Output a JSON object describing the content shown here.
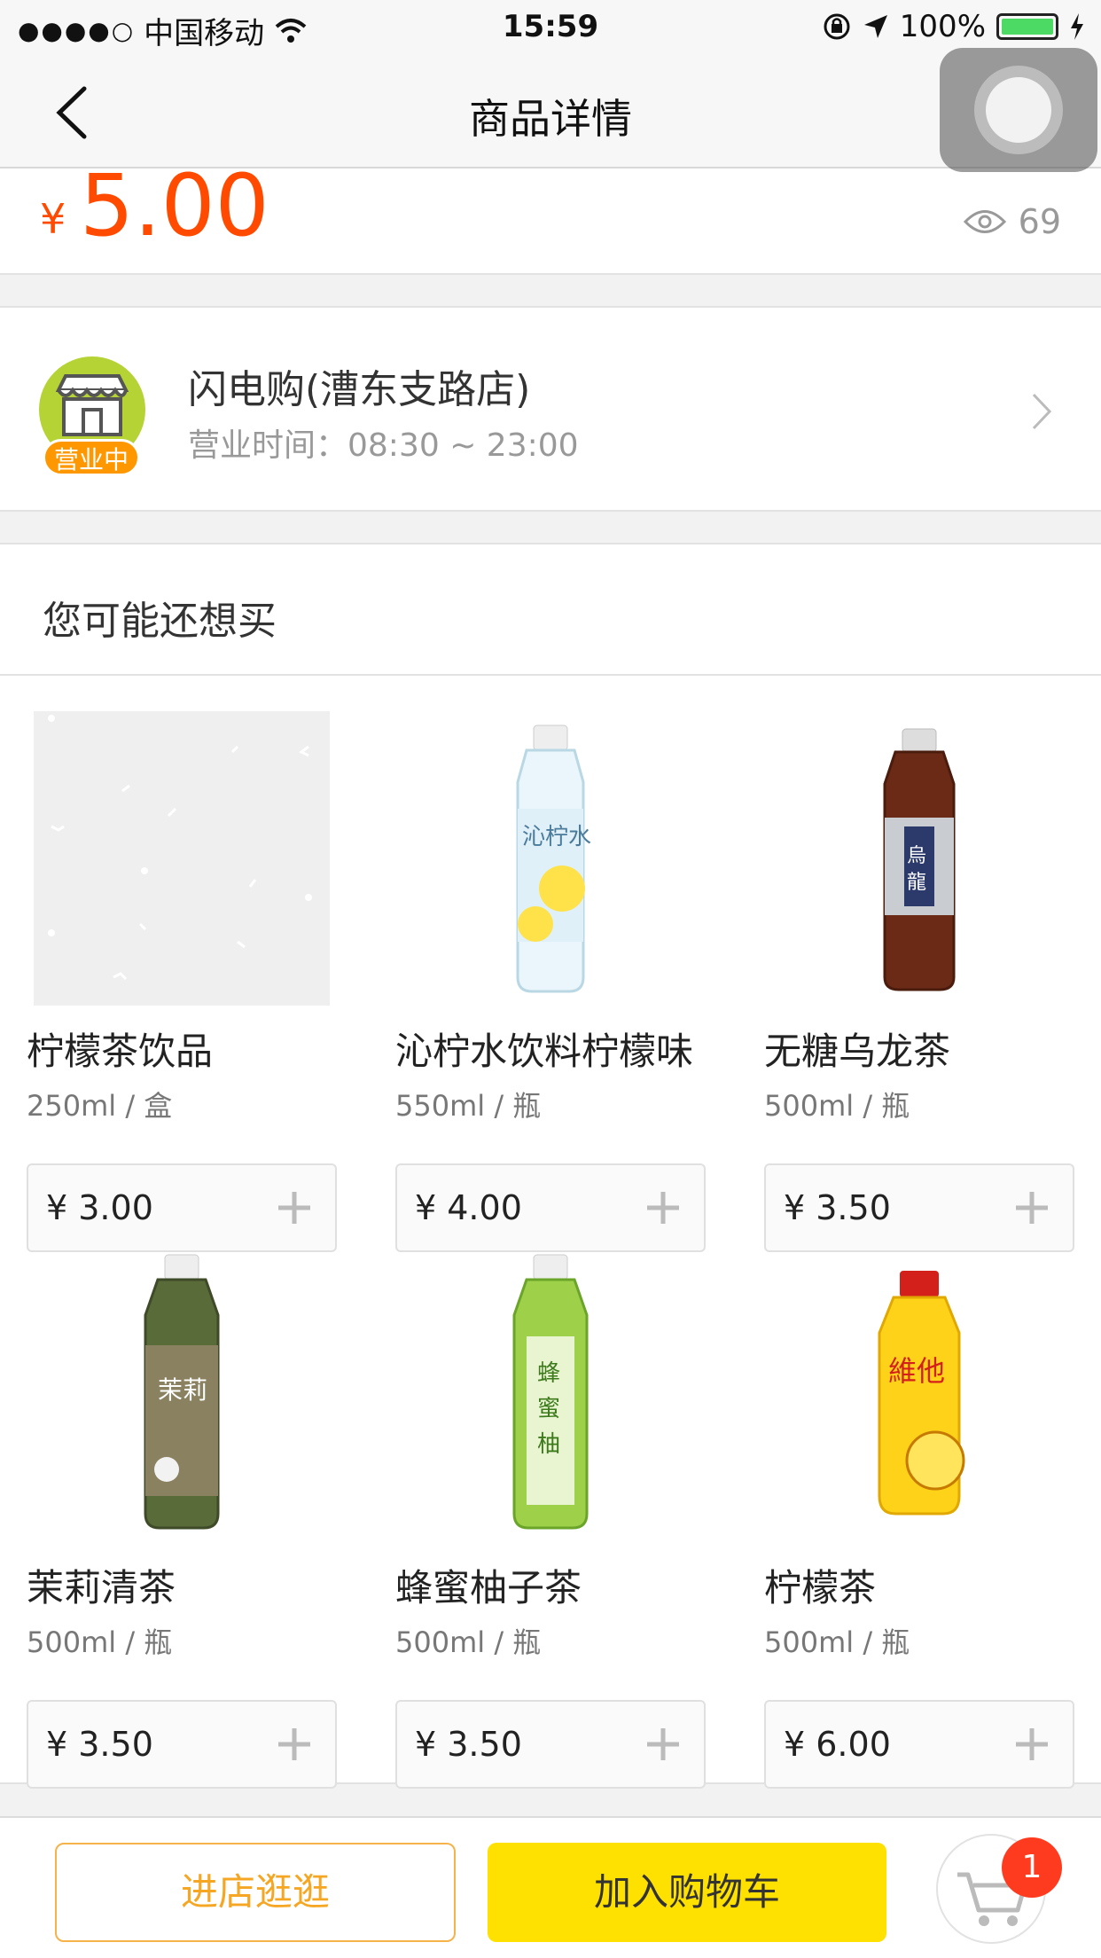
{
  "status_bar": {
    "carrier": "中国移动",
    "time": "15:59",
    "battery": "100%"
  },
  "nav": {
    "title": "商品详情"
  },
  "product": {
    "currency": "¥",
    "price": "5.00",
    "views": "69"
  },
  "store": {
    "name": "闪电购(漕东支路店)",
    "hours": "营业时间：08:30 ~ 23:00",
    "badge": "营业中"
  },
  "recommend": {
    "title": "您可能还想买",
    "items": [
      {
        "name": "柠檬茶饮品",
        "spec": "250ml / 盒",
        "price": "¥ 3.00"
      },
      {
        "name": "沁柠水饮料柠檬味",
        "spec": "550ml / 瓶",
        "price": "¥ 4.00"
      },
      {
        "name": "无糖乌龙茶",
        "spec": "500ml / 瓶",
        "price": "¥ 3.50"
      },
      {
        "name": "茉莉清茶",
        "spec": "500ml / 瓶",
        "price": "¥ 3.50"
      },
      {
        "name": "蜂蜜柚子茶",
        "spec": "500ml / 瓶",
        "price": "¥ 3.50"
      },
      {
        "name": "柠檬茶",
        "spec": "500ml / 瓶",
        "price": "¥ 6.00"
      }
    ]
  },
  "bottom_bar": {
    "store_button": "进店逛逛",
    "cart_button": "加入购物车",
    "cart_count": "1"
  },
  "colors": {
    "price": "#ff4a00",
    "cart_button": "#ffe100",
    "store_button_border": "#f5b34a",
    "badge": "#ff3b1f"
  }
}
